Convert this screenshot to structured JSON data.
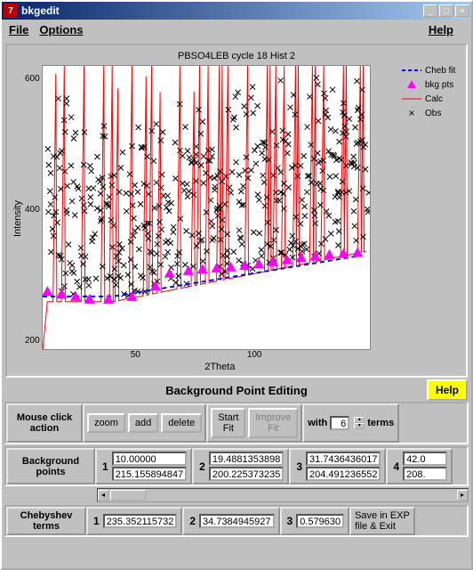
{
  "window": {
    "title": "bkgedit"
  },
  "menu": {
    "file": "File",
    "options": "Options",
    "help": "Help"
  },
  "chart": {
    "title": "PBSO4LEB cycle 18 Hist 2",
    "xlabel": "2Theta",
    "ylabel": "Intensity",
    "legend": {
      "cheb": "Cheb fit",
      "bkg": "bkg pts",
      "calc": "Calc",
      "obs": "Obs"
    }
  },
  "chart_data": {
    "type": "scatter",
    "title": "PBSO4LEB cycle 18 Hist 2",
    "xlabel": "2Theta",
    "ylabel": "Intensity",
    "xlim": [
      10,
      150
    ],
    "ylim": [
      100,
      650
    ],
    "xticks": [
      50,
      100
    ],
    "yticks": [
      200,
      400,
      600
    ],
    "series": [
      {
        "name": "Cheb fit",
        "style": "dashed",
        "color": "#0000ff"
      },
      {
        "name": "bkg pts",
        "style": "triangle",
        "color": "#ff00ff"
      },
      {
        "name": "Calc",
        "style": "line",
        "color": "#ff0000"
      },
      {
        "name": "Obs",
        "style": "x",
        "color": "#000000"
      }
    ],
    "bkg_points_x": [
      12,
      18,
      24,
      30,
      38,
      48,
      58,
      64,
      72,
      78,
      84,
      90,
      96,
      102,
      108,
      114,
      120,
      126,
      132,
      138,
      144
    ],
    "bkg_points_y": [
      215,
      210,
      205,
      200,
      200,
      205,
      225,
      250,
      255,
      258,
      260,
      262,
      265,
      268,
      272,
      276,
      280,
      283,
      286,
      288,
      290
    ]
  },
  "panel": {
    "title": "Background Point Editing",
    "help": "Help",
    "mouse_label": "Mouse click\naction",
    "zoom": "zoom",
    "add": "add",
    "delete": "delete",
    "start_fit": "Start\nFit",
    "improve_fit": "Improve\nFit",
    "with": "with",
    "terms": "terms",
    "fit_terms_value": "6",
    "bg_label": "Background\npoints",
    "cheb_label": "Chebyshev\nterms",
    "save_exp": "Save in EXP\nfile & Exit"
  },
  "bg_points": [
    {
      "n": "1",
      "a": "10.00000",
      "b": "215.155894847"
    },
    {
      "n": "2",
      "a": "19.4881353898",
      "b": "200.225373235"
    },
    {
      "n": "3",
      "a": "31.7436436017",
      "b": "204.491236552"
    },
    {
      "n": "4",
      "a": "42.0",
      "b": "208."
    }
  ],
  "cheb_terms": [
    {
      "n": "1",
      "v": "235.352115732"
    },
    {
      "n": "2",
      "v": "34.7384945927"
    },
    {
      "n": "3",
      "v": "0.579630"
    }
  ]
}
